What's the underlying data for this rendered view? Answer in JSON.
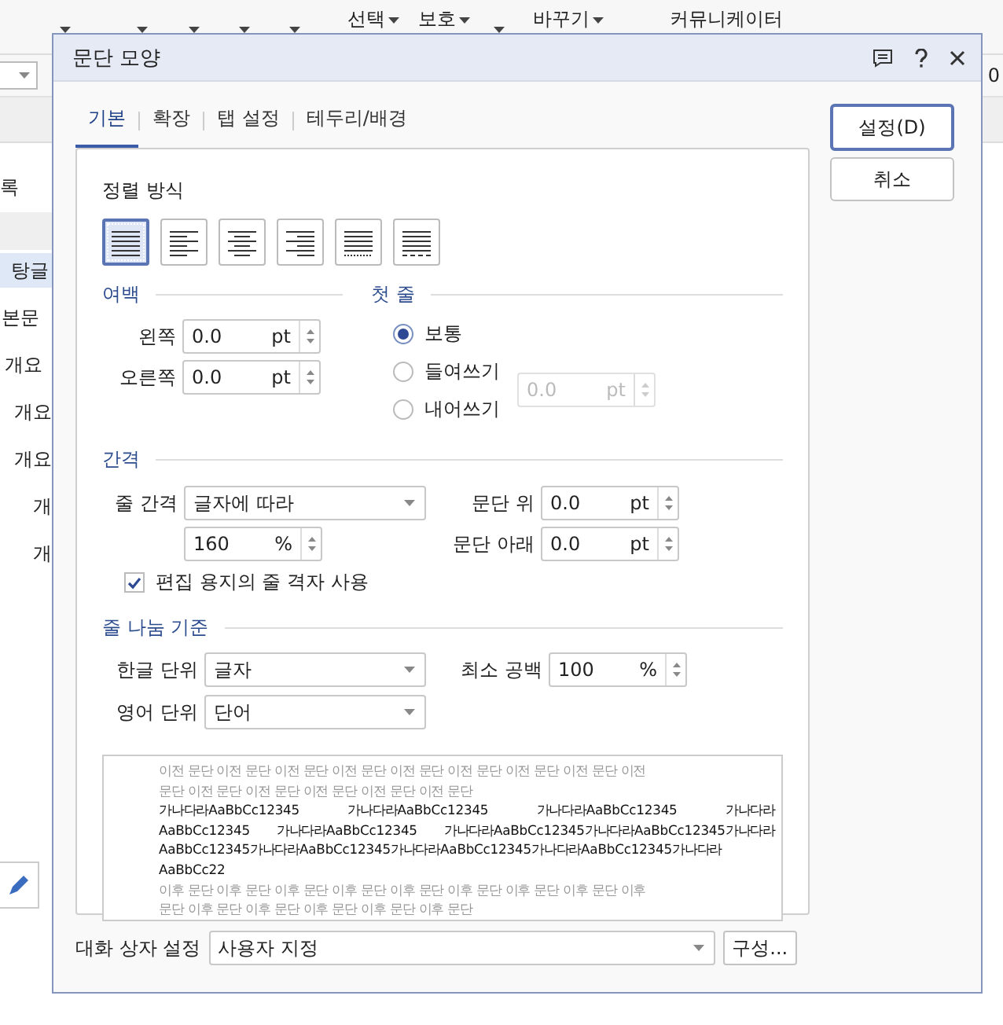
{
  "ribbon": {
    "items": [
      {
        "caret": true
      },
      {
        "caret": true
      },
      {
        "caret": true
      },
      {
        "caret": true
      },
      {
        "caret": true
      },
      {
        "label": "선택",
        "caret": true
      },
      {
        "label": "보호",
        "caret": true
      },
      {
        "caret": true
      },
      {
        "label": "바꾸기",
        "caret": true
      },
      {
        "label": "커뮤니케이터",
        "caret": false
      }
    ]
  },
  "toolbar": {
    "value": "0"
  },
  "side_panel": {
    "title": "록",
    "items": [
      {
        "label": "탕글",
        "selected": true
      },
      {
        "label": "본문",
        "selected": false
      },
      {
        "label": "개요",
        "selected": false
      },
      {
        "label": "개요",
        "selected": false
      },
      {
        "label": "개요",
        "selected": false
      },
      {
        "label": "개",
        "selected": false
      },
      {
        "label": "개",
        "selected": false
      }
    ]
  },
  "dialog": {
    "title": "문단 모양",
    "tabs": [
      {
        "label": "기본",
        "selected": true
      },
      {
        "label": "확장",
        "selected": false
      },
      {
        "label": "탭 설정",
        "selected": false
      },
      {
        "label": "테두리/배경",
        "selected": false
      }
    ],
    "buttons": [
      {
        "label": "설정(D)",
        "default": true
      },
      {
        "label": "취소",
        "default": false
      }
    ],
    "alignment": {
      "label": "정렬 방식",
      "options": [
        {
          "kind": "justify",
          "selected": true
        },
        {
          "kind": "left",
          "selected": false
        },
        {
          "kind": "center",
          "selected": false
        },
        {
          "kind": "right",
          "selected": false
        },
        {
          "kind": "distribute",
          "selected": false
        },
        {
          "kind": "divide",
          "selected": false
        }
      ]
    },
    "margins": {
      "label": "여백",
      "fields": [
        {
          "label": "왼쪽",
          "value": "0.0",
          "unit": "pt"
        },
        {
          "label": "오른쪽",
          "value": "0.0",
          "unit": "pt"
        }
      ]
    },
    "first_line": {
      "label": "첫 줄",
      "options": [
        {
          "label": "보통",
          "selected": true
        },
        {
          "label": "들여쓰기",
          "selected": false
        },
        {
          "label": "내어쓰기",
          "selected": false
        }
      ],
      "field": {
        "value": "0.0",
        "unit": "pt",
        "disabled": true
      }
    },
    "spacing": {
      "label": "간격",
      "line_spacing": {
        "label": "줄 간격",
        "value": "글자에 따라"
      },
      "line_spacing_amount": {
        "value": "160",
        "unit": "%"
      },
      "above": {
        "label": "문단 위",
        "value": "0.0",
        "unit": "pt"
      },
      "below": {
        "label": "문단 아래",
        "value": "0.0",
        "unit": "pt"
      },
      "grid": {
        "label": "편집 용지의 줄 격자 사용",
        "checked": true
      }
    },
    "line_break": {
      "label": "줄 나눔 기준",
      "korean": {
        "label": "한글 단위",
        "value": "글자"
      },
      "min_space": {
        "label": "최소 공백",
        "value": "100",
        "unit": "%"
      },
      "english": {
        "label": "영어 단위",
        "value": "단어"
      }
    },
    "preview": {
      "lines": [
        {
          "kind": "other",
          "text": "이전 문단 이전 문단 이전 문단 이전 문단 이전 문단 이전 문단 이전 문단 이전 문단 이전"
        },
        {
          "kind": "other",
          "text": "문단 이전 문단 이전 문단 이전 문단 이전 문단 이전 문단"
        },
        {
          "kind": "current",
          "text": "가나다라AaBbCc12345 가나다라AaBbCc12345 가나다라AaBbCc12345 가나다라"
        },
        {
          "kind": "current",
          "text": "AaBbCc12345 가나다라AaBbCc12345 가나다라AaBbCc12345가나다라AaBbCc12345가나다라"
        },
        {
          "kind": "current",
          "text": "AaBbCc12345가나다라AaBbCc12345가나다라AaBbCc12345가나다라AaBbCc12345가나다라"
        },
        {
          "kind": "current_last",
          "text": "AaBbCc22"
        },
        {
          "kind": "other",
          "text": "이후 문단 이후 문단 이후 문단 이후 문단 이후 문단 이후 문단 이후 문단 이후 문단 이후"
        },
        {
          "kind": "other",
          "text": "문단 이후 문단 이후 문단 이후 문단 이후 문단 이후 문단"
        }
      ]
    },
    "preset": {
      "label": "대화 상자 설정",
      "value": "사용자 지정"
    },
    "configure_button": "구성..."
  }
}
